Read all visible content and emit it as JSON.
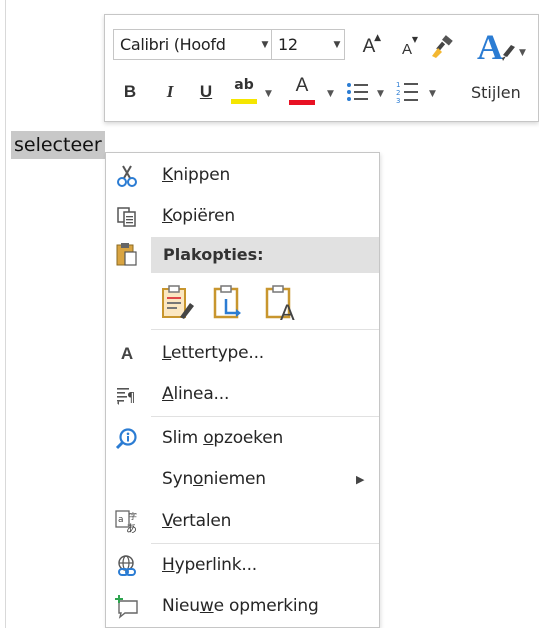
{
  "document": {
    "selected_text": "selecteer"
  },
  "mini_toolbar": {
    "font_name": "Calibri (Hoofd",
    "font_size": "12",
    "grow_font_label": "A",
    "shrink_font_label": "A",
    "bold_label": "B",
    "italic_label": "I",
    "underline_label": "U",
    "highlight_label": "ab",
    "font_color_label": "A",
    "styles_label": "Stijlen",
    "colors": {
      "highlight": "#f5e600",
      "font_color": "#e81123",
      "accent_blue": "#2b7cd3"
    }
  },
  "context_menu": {
    "items": [
      {
        "pre": "",
        "acc": "K",
        "post": "nippen",
        "icon": "scissors-icon"
      },
      {
        "pre": "",
        "acc": "K",
        "post": "opiëren",
        "icon": "copy-icon"
      },
      {
        "pre": "",
        "acc": "",
        "post": "",
        "icon": "paste-icon"
      },
      {
        "pre": "",
        "acc": "L",
        "post": "ettertype...",
        "icon": "font-icon"
      },
      {
        "pre": "",
        "acc": "A",
        "post": "linea...",
        "icon": "paragraph-icon"
      },
      {
        "pre": "Slim ",
        "acc": "o",
        "post": "pzoeken",
        "icon": "smart-lookup-icon"
      },
      {
        "pre": "Syn",
        "acc": "o",
        "post": "niemen",
        "icon": "none"
      },
      {
        "pre": "",
        "acc": "V",
        "post": "ertalen",
        "icon": "translate-icon"
      },
      {
        "pre": "",
        "acc": "H",
        "post": "yperlink...",
        "icon": "hyperlink-icon"
      },
      {
        "pre": "Nieu",
        "acc": "w",
        "post": "e opmerking",
        "icon": "new-comment-icon"
      }
    ],
    "paste_header": "Plakopties:",
    "paste_options": [
      "keep-source-formatting-icon",
      "merge-formatting-icon",
      "keep-text-only-icon"
    ]
  }
}
